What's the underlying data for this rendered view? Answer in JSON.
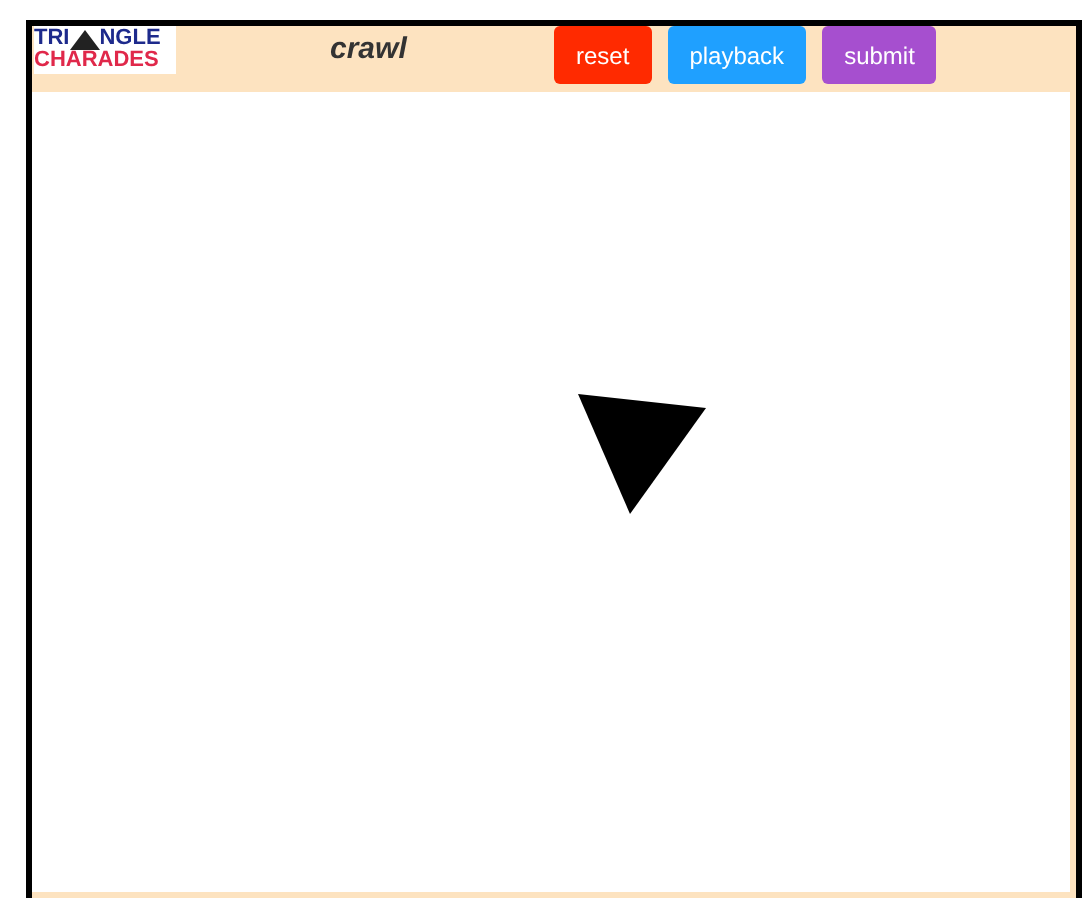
{
  "logo": {
    "top_left": "TRI",
    "top_right": "NGLE",
    "bottom": "CHARADES"
  },
  "word": "crawl",
  "buttons": [
    {
      "label": "reset",
      "color": "#ff2a00"
    },
    {
      "label": "playback",
      "color": "#1fa0ff"
    },
    {
      "label": "submit",
      "color": "#a64fcf"
    }
  ]
}
